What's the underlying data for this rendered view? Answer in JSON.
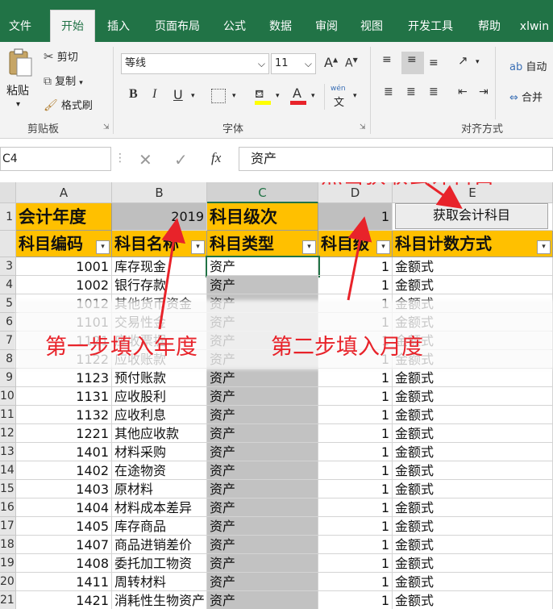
{
  "tabs": [
    "文件",
    "开始",
    "插入",
    "页面布局",
    "公式",
    "数据",
    "审阅",
    "视图",
    "开发工具",
    "帮助",
    "xlwin"
  ],
  "ribbon": {
    "paste_label": "粘贴",
    "cut_label": "剪切",
    "copy_label": "复制",
    "format_painter_label": "格式刷",
    "clipboard_group": "剪贴板",
    "font_name": "等线",
    "font_size": "11",
    "font_group": "字体",
    "bold": "B",
    "italic": "I",
    "underline": "U",
    "wen_label": "wén",
    "wen_char": "文",
    "align_group": "对齐方式",
    "wrap_label": "自动",
    "merge_label": "合并"
  },
  "formula_bar": {
    "name_box": "C4",
    "fx": "fx",
    "content": "资产"
  },
  "columns": [
    "A",
    "B",
    "C",
    "D",
    "E"
  ],
  "row_numbers": [
    "1",
    "",
    "3",
    "4",
    "5",
    "6",
    "7",
    "8",
    "9",
    "10",
    "11",
    "12",
    "13",
    "14",
    "15",
    "16",
    "17",
    "18",
    "19",
    "20",
    "21"
  ],
  "row1": {
    "label_year": "会计年度",
    "year": "2019",
    "label_level": "科目级次",
    "level": "1"
  },
  "button_label": "获取会计科目",
  "headers": [
    "科目编码",
    "科目名称",
    "科目类型",
    "科目级",
    "科目计数方式"
  ],
  "rows": [
    [
      "1001",
      "库存现金",
      "资产",
      "1",
      "金额式"
    ],
    [
      "1002",
      "银行存款",
      "资产",
      "1",
      "金额式"
    ],
    [
      "1012",
      "其他货币资金",
      "资产",
      "1",
      "金额式"
    ],
    [
      "1101",
      "交易性金",
      "资产",
      "1",
      "金额式"
    ],
    [
      "1121",
      "应收票据",
      "资产",
      "1",
      "金额式"
    ],
    [
      "1122",
      "应收账款",
      "资产",
      "1",
      "金额式"
    ],
    [
      "1123",
      "预付账款",
      "资产",
      "1",
      "金额式"
    ],
    [
      "1131",
      "应收股利",
      "资产",
      "1",
      "金额式"
    ],
    [
      "1132",
      "应收利息",
      "资产",
      "1",
      "金额式"
    ],
    [
      "1221",
      "其他应收款",
      "资产",
      "1",
      "金额式"
    ],
    [
      "1401",
      "材料采购",
      "资产",
      "1",
      "金额式"
    ],
    [
      "1402",
      "在途物资",
      "资产",
      "1",
      "金额式"
    ],
    [
      "1403",
      "原材料",
      "资产",
      "1",
      "金额式"
    ],
    [
      "1404",
      "材料成本差异",
      "资产",
      "1",
      "金额式"
    ],
    [
      "1405",
      "库存商品",
      "资产",
      "1",
      "金额式"
    ],
    [
      "1407",
      "商品进销差价",
      "资产",
      "1",
      "金额式"
    ],
    [
      "1408",
      "委托加工物资",
      "资产",
      "1",
      "金额式"
    ],
    [
      "1411",
      "周转材料",
      "资产",
      "1",
      "金额式"
    ],
    [
      "1421",
      "消耗性生物资产",
      "资产",
      "1",
      "金额式"
    ]
  ],
  "annotations": {
    "click_fetch": "点击获取会计科目",
    "step1": "第一步填入年度",
    "step2": "第二步填入月度"
  },
  "colors": {
    "header_fill": "#ffc000",
    "annotation": "#e8232a",
    "ribbon_green": "#217346"
  }
}
